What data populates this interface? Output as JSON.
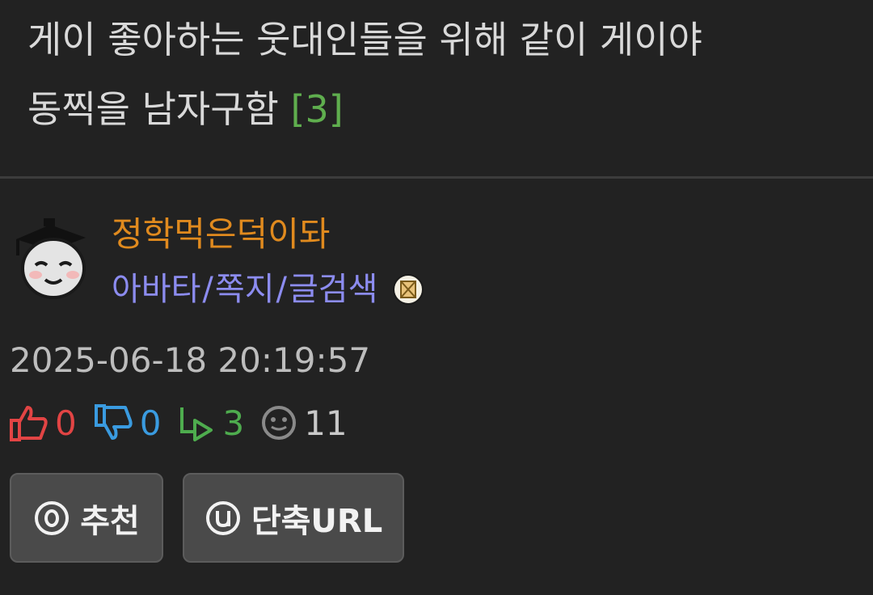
{
  "post": {
    "title_line1": "게이 좋아하는 웃대인들을 위해 같이 게이야",
    "title_line2": "동찍을 남자구함",
    "reply_badge": "[3]"
  },
  "author": {
    "name": "정학먹은덕이돠",
    "links": [
      "아바타",
      "쪽지",
      "글검색"
    ],
    "link_separator": "/",
    "avatar_icon": "scholar-ghost-avatar",
    "message_icon": "envelope-icon"
  },
  "timestamp": "2025-06-18 20:19:57",
  "stats": {
    "upvotes": "0",
    "downvotes": "0",
    "replies": "3",
    "views": "11"
  },
  "buttons": {
    "recommend_label": "추천",
    "shorturl_label": "단축URL"
  },
  "colors": {
    "background": "#222222",
    "author_name": "#e08a1e",
    "author_links": "#8c8cf0",
    "upvote": "#e24444",
    "downvote": "#3a9be0",
    "reply": "#4eac4e",
    "reply_badge": "#5fae4e"
  }
}
